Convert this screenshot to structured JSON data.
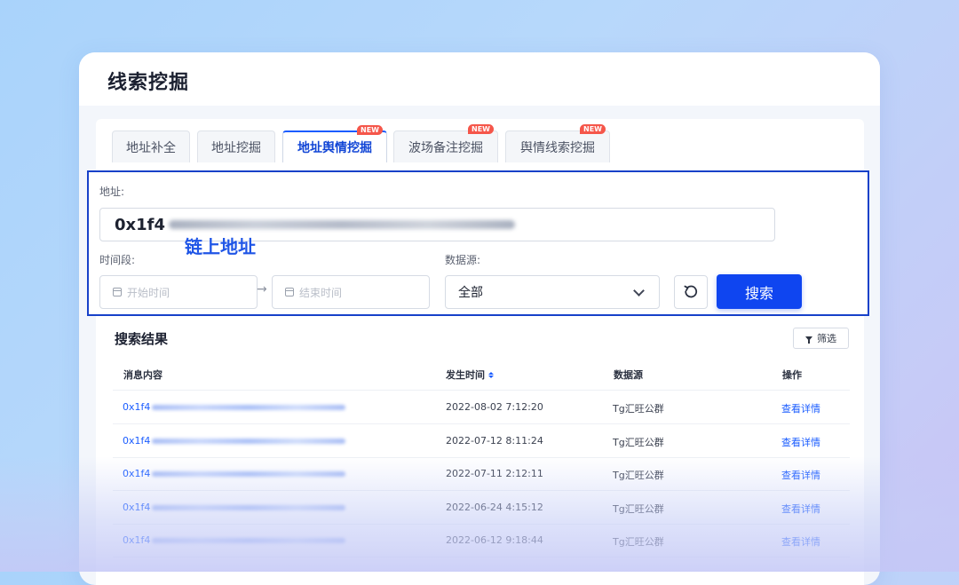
{
  "page": {
    "title": "线索挖掘"
  },
  "tabs": [
    {
      "label": "地址补全",
      "badge": "",
      "active": false
    },
    {
      "label": "地址挖掘",
      "badge": "",
      "active": false
    },
    {
      "label": "地址舆情挖掘",
      "badge": "NEW",
      "active": true
    },
    {
      "label": "波场备注挖掘",
      "badge": "NEW",
      "active": false
    },
    {
      "label": "舆情线索挖掘",
      "badge": "NEW",
      "active": false
    }
  ],
  "form": {
    "address_label": "地址:",
    "address_value": "0x1f4",
    "chain_address_annotation": "链上地址",
    "time_label": "时间段:",
    "start_placeholder": "开始时间",
    "end_placeholder": "结束时间",
    "range_separator": "→",
    "source_label": "数据源:",
    "source_value": "全部",
    "search_button": "搜索"
  },
  "results": {
    "title": "搜索结果",
    "filter_button": "筛选",
    "columns": [
      "消息内容",
      "发生时间",
      "数据源",
      "操作"
    ],
    "rows": [
      {
        "content": "0x1f4",
        "time": "2022-08-02 7:12:20",
        "source": "Tg汇旺公群",
        "action": "查看详情"
      },
      {
        "content": "0x1f4",
        "time": "2022-07-12 8:11:24",
        "source": "Tg汇旺公群",
        "action": "查看详情"
      },
      {
        "content": "0x1f4",
        "time": "2022-07-11 2:12:11",
        "source": "Tg汇旺公群",
        "action": "查看详情"
      },
      {
        "content": "0x1f4",
        "time": "2022-06-24 4:15:12",
        "source": "Tg汇旺公群",
        "action": "查看详情"
      },
      {
        "content": "0x1f4",
        "time": "2022-06-12 9:18:44",
        "source": "Tg汇旺公群",
        "action": "查看详情"
      }
    ]
  },
  "colors": {
    "accent": "#1a5cff",
    "primary_button": "#0f45f0",
    "highlight_border": "#1741c9",
    "new_badge": "#f5564a"
  },
  "icons": {
    "calendar": "calendar-icon",
    "dropdown": "chevron-down-icon",
    "reset": "refresh-icon",
    "filter": "filter-icon",
    "sort": "sort-icon"
  }
}
